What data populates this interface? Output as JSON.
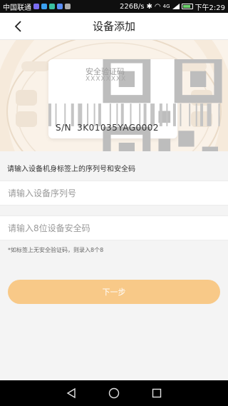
{
  "status_bar": {
    "carrier": "中国联通",
    "speed": "226B/s",
    "network": "4G",
    "time": "下午2:29"
  },
  "header": {
    "title": "设备添加"
  },
  "label_card": {
    "verify_title": "安全验证码",
    "verify_code": "XXXXXXXX",
    "sn_prefix": "S/N",
    "sn_value": "3K01035YAG0002"
  },
  "form": {
    "instruction": "请输入设备机身标签上的序列号和安全码",
    "serial": {
      "value": "",
      "placeholder": "请输入设备序列号"
    },
    "code": {
      "value": "",
      "placeholder": "请输入8位设备安全码"
    },
    "hint": "*如标签上无安全验证码，则录入8个8",
    "next_label": "下一步"
  },
  "colors": {
    "accent": "#f8c988",
    "hero_bg": "#faf3ea"
  }
}
